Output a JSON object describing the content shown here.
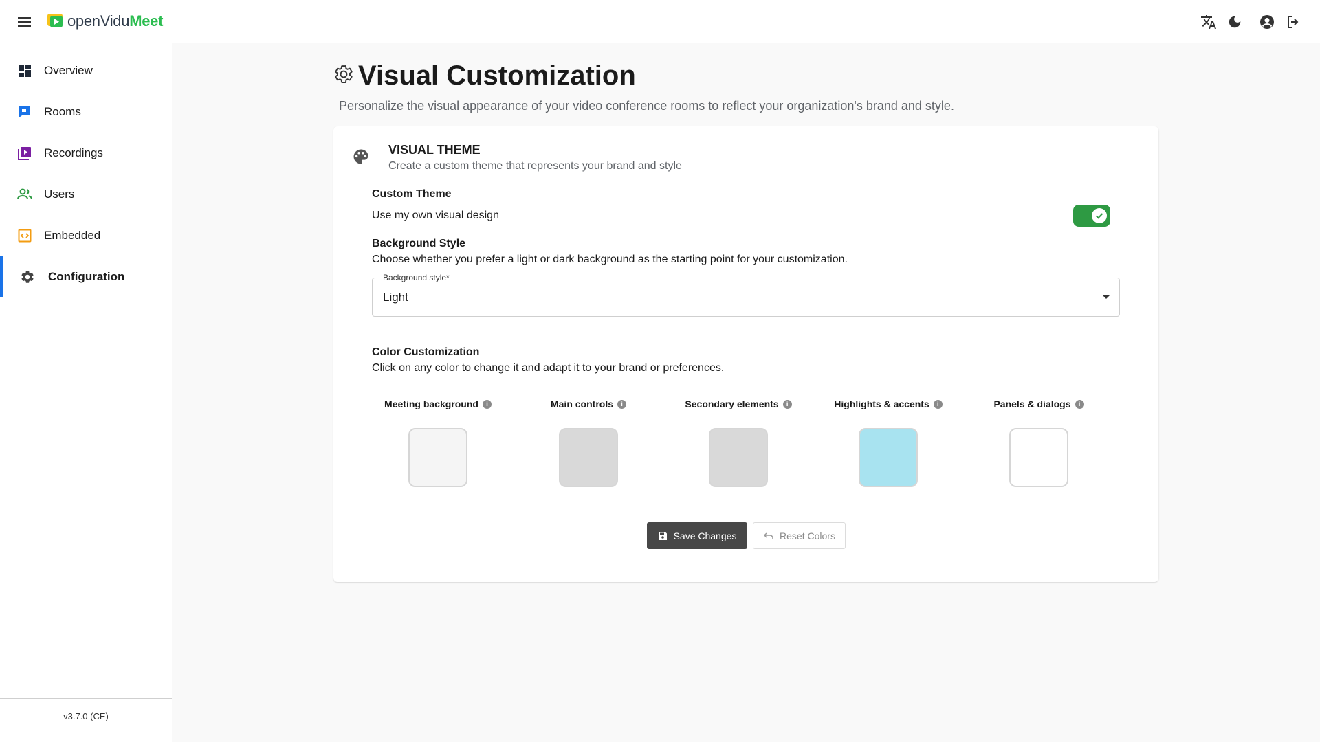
{
  "header": {
    "logo": {
      "part1": "openVidu",
      "part2": "Meet"
    },
    "icons": [
      "translate-icon",
      "dark-mode-icon",
      "account-icon",
      "logout-icon"
    ]
  },
  "sidebar": {
    "items": [
      {
        "label": "Overview",
        "icon": "dashboard-icon",
        "color": "#1f2937"
      },
      {
        "label": "Rooms",
        "icon": "rooms-icon",
        "color": "#1a73e8"
      },
      {
        "label": "Recordings",
        "icon": "recordings-icon",
        "color": "#7b1fa2"
      },
      {
        "label": "Users",
        "icon": "users-icon",
        "color": "#2e9a43"
      },
      {
        "label": "Embedded",
        "icon": "embedded-icon",
        "color": "#f39c12"
      },
      {
        "label": "Configuration",
        "icon": "gear-icon",
        "active": true
      }
    ],
    "version": "v3.7.0 (CE)"
  },
  "page": {
    "title": "Visual Customization",
    "subtitle": "Personalize the visual appearance of your video conference rooms to reflect your organization's brand and style."
  },
  "theme": {
    "title": "VISUAL THEME",
    "description": "Create a custom theme that represents your brand and style",
    "custom_theme": {
      "label": "Custom Theme",
      "description": "Use my own visual design",
      "enabled": true
    },
    "background_style": {
      "label": "Background Style",
      "description": "Choose whether you prefer a light or dark background as the starting point for your customization.",
      "field_label": "Background style*",
      "value": "Light"
    },
    "colors": {
      "label": "Color Customization",
      "description": "Click on any color to change it and adapt it to your brand or preferences.",
      "swatches": [
        {
          "label": "Meeting background",
          "color": "#f5f5f5"
        },
        {
          "label": "Main controls",
          "color": "#d9d9d9"
        },
        {
          "label": "Secondary elements",
          "color": "#d9d9d9"
        },
        {
          "label": "Highlights & accents",
          "color": "#a8e3f0"
        },
        {
          "label": "Panels & dialogs",
          "color": "#ffffff"
        }
      ]
    },
    "save_label": "Save Changes",
    "reset_label": "Reset Colors"
  }
}
